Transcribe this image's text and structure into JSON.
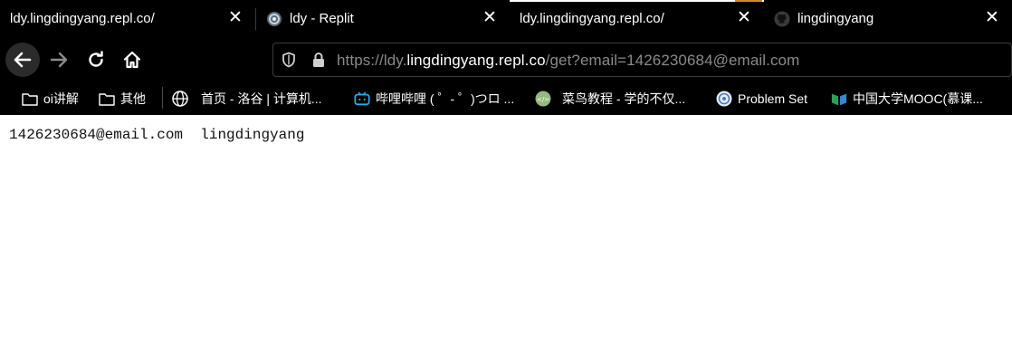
{
  "tabs": [
    {
      "title": "ldy.lingdingyang.repl.co/",
      "icon": "none",
      "active": false
    },
    {
      "title": "ldy - Replit",
      "icon": "replit-icon",
      "active": false
    },
    {
      "title": "ldy.lingdingyang.repl.co/",
      "icon": "none",
      "active": true
    },
    {
      "title": "lingdingyang",
      "icon": "github-icon",
      "active": false
    }
  ],
  "tab_close_glyph": "✕",
  "address_bar": {
    "scheme": "https://ldy.",
    "host": "lingdingyang.repl.co",
    "path": "/get?email=1426230684@email.com"
  },
  "bookmarks": [
    {
      "label": "oi讲解",
      "icon": "folder-icon"
    },
    {
      "label": "其他",
      "icon": "folder-icon"
    },
    {
      "label": "首页 - 洛谷 | 计算机...",
      "icon": "globe-icon"
    },
    {
      "label": "哔哩哔哩 ( ゜- ゜)つロ ...",
      "icon": "bilibili-icon"
    },
    {
      "label": "菜鸟教程 - 学的不仅...",
      "icon": "runoob-icon"
    },
    {
      "label": "Problem Set",
      "icon": "problemset-icon"
    },
    {
      "label": "中国大学MOOC(慕课...",
      "icon": "mooc-icon"
    }
  ],
  "page": {
    "output": "1426230684@email.com  lingdingyang"
  },
  "colors": {
    "chrome_bg": "#000000",
    "page_bg": "#ffffff",
    "url_muted": "#8a8a8a"
  }
}
